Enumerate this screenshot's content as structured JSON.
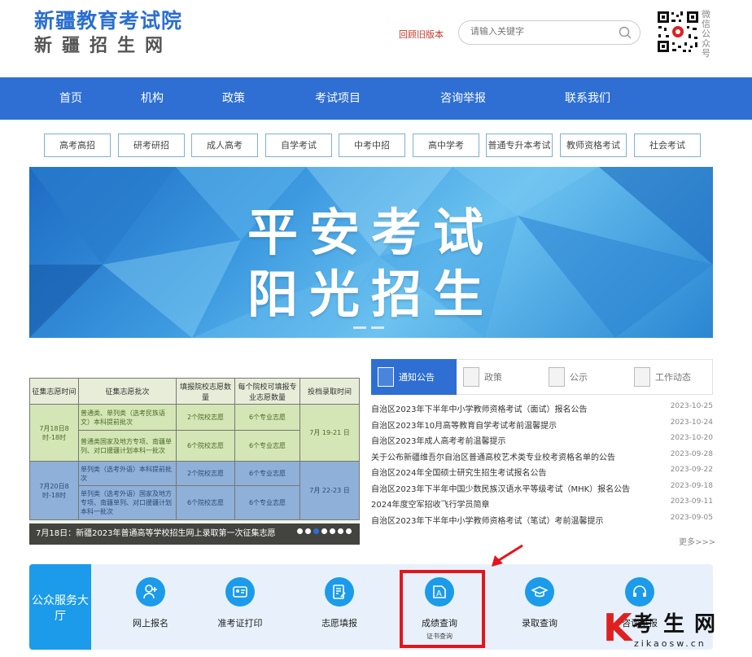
{
  "header": {
    "logo_main": "新疆教育考试院",
    "logo_sub": "新疆招生网",
    "old_version": "回顾旧版本",
    "search_placeholder": "请输入关键字",
    "qr_label": "微信公众号"
  },
  "nav": {
    "items": [
      "首页",
      "机构",
      "政策",
      "考试项目",
      "咨询举报",
      "联系我们"
    ]
  },
  "exam_tabs": [
    "高考高招",
    "研考研招",
    "成人高考",
    "自学考试",
    "中考中招",
    "高中学考",
    "普通专升本考试",
    "教师资格考试",
    "社会考试"
  ],
  "banner": {
    "line1": "平安考试",
    "line2": "阳光招生"
  },
  "news_image": {
    "headers": [
      "征集志愿时间",
      "征集志愿批次",
      "填报院校志愿数量",
      "每个院校可填报专业志愿数量",
      "投档录取时间"
    ],
    "rows": [
      {
        "time": "7月18日8时-18时",
        "batch": "普通类、单列类（选考民族语文）本科提前批次",
        "schools": "2个院校志愿",
        "majors": "6个专业志愿",
        "admit": "7月 19-21 日"
      },
      {
        "time": "",
        "batch": "普通类国家及地方专项、南疆单列、对口援疆计划本科一批次",
        "schools": "6个院校志愿",
        "majors": "6个专业志愿",
        "admit": ""
      },
      {
        "time": "7月20日8时-18时",
        "batch": "单列类（选考外语）本科提前批次",
        "schools": "2个院校志愿",
        "majors": "6个专业志愿",
        "admit": "7月 22-23 日"
      },
      {
        "time": "",
        "batch": "单列类（选考外语）国家及地方专项、南疆单列、对口援疆计划本科一批次",
        "schools": "6个院校志愿",
        "majors": "6个专业志愿",
        "admit": ""
      }
    ],
    "caption": "7月18日：新疆2023年普通高等学校招生网上录取第一次征集志愿"
  },
  "news_tabs": [
    "通知公告",
    "政策",
    "公示",
    "工作动态"
  ],
  "news": [
    {
      "title": "自治区2023年下半年中小学教师资格考试（面试）报名公告",
      "date": "2023-10-25"
    },
    {
      "title": "自治区2023年10月高等教育自学考试考前温馨提示",
      "date": "2023-10-24"
    },
    {
      "title": "自治区2023年成人高考考前温馨提示",
      "date": "2023-10-20"
    },
    {
      "title": "关于公布新疆维吾尔自治区普通高校艺术类专业校考资格名单的公告",
      "date": "2023-09-28"
    },
    {
      "title": "自治区2024年全国硕士研究生招生考试报名公告",
      "date": "2023-09-22"
    },
    {
      "title": "自治区2023年下半年中国少数民族汉语水平等级考试（MHK）报名公告",
      "date": "2023-09-18"
    },
    {
      "title": "2024年度空军招收飞行学员简章",
      "date": "2023-09-11"
    },
    {
      "title": "自治区2023年下半年中小学教师资格考试（笔试）考前温馨提示",
      "date": "2023-09-05"
    }
  ],
  "more": "更多>>>",
  "service": {
    "title": "公众服务大厅",
    "items": [
      {
        "name": "网上报名",
        "icon": "user-register-icon",
        "sub": ""
      },
      {
        "name": "准考证打印",
        "icon": "id-card-icon",
        "sub": ""
      },
      {
        "name": "志愿填报",
        "icon": "form-edit-icon",
        "sub": ""
      },
      {
        "name": "成绩查询",
        "icon": "score-search-icon",
        "sub": "证书查询"
      },
      {
        "name": "录取查询",
        "icon": "graduation-cap-icon",
        "sub": ""
      },
      {
        "name": "咨询举报",
        "icon": "headset-icon",
        "sub": ""
      }
    ]
  },
  "watermark": {
    "letter": "K",
    "name": "考生网",
    "url": "zikaosw.cn"
  },
  "colors": {
    "nav_blue": "#2f6fd3",
    "service_blue": "#1b9bea",
    "highlight_red": "#e4151b"
  }
}
